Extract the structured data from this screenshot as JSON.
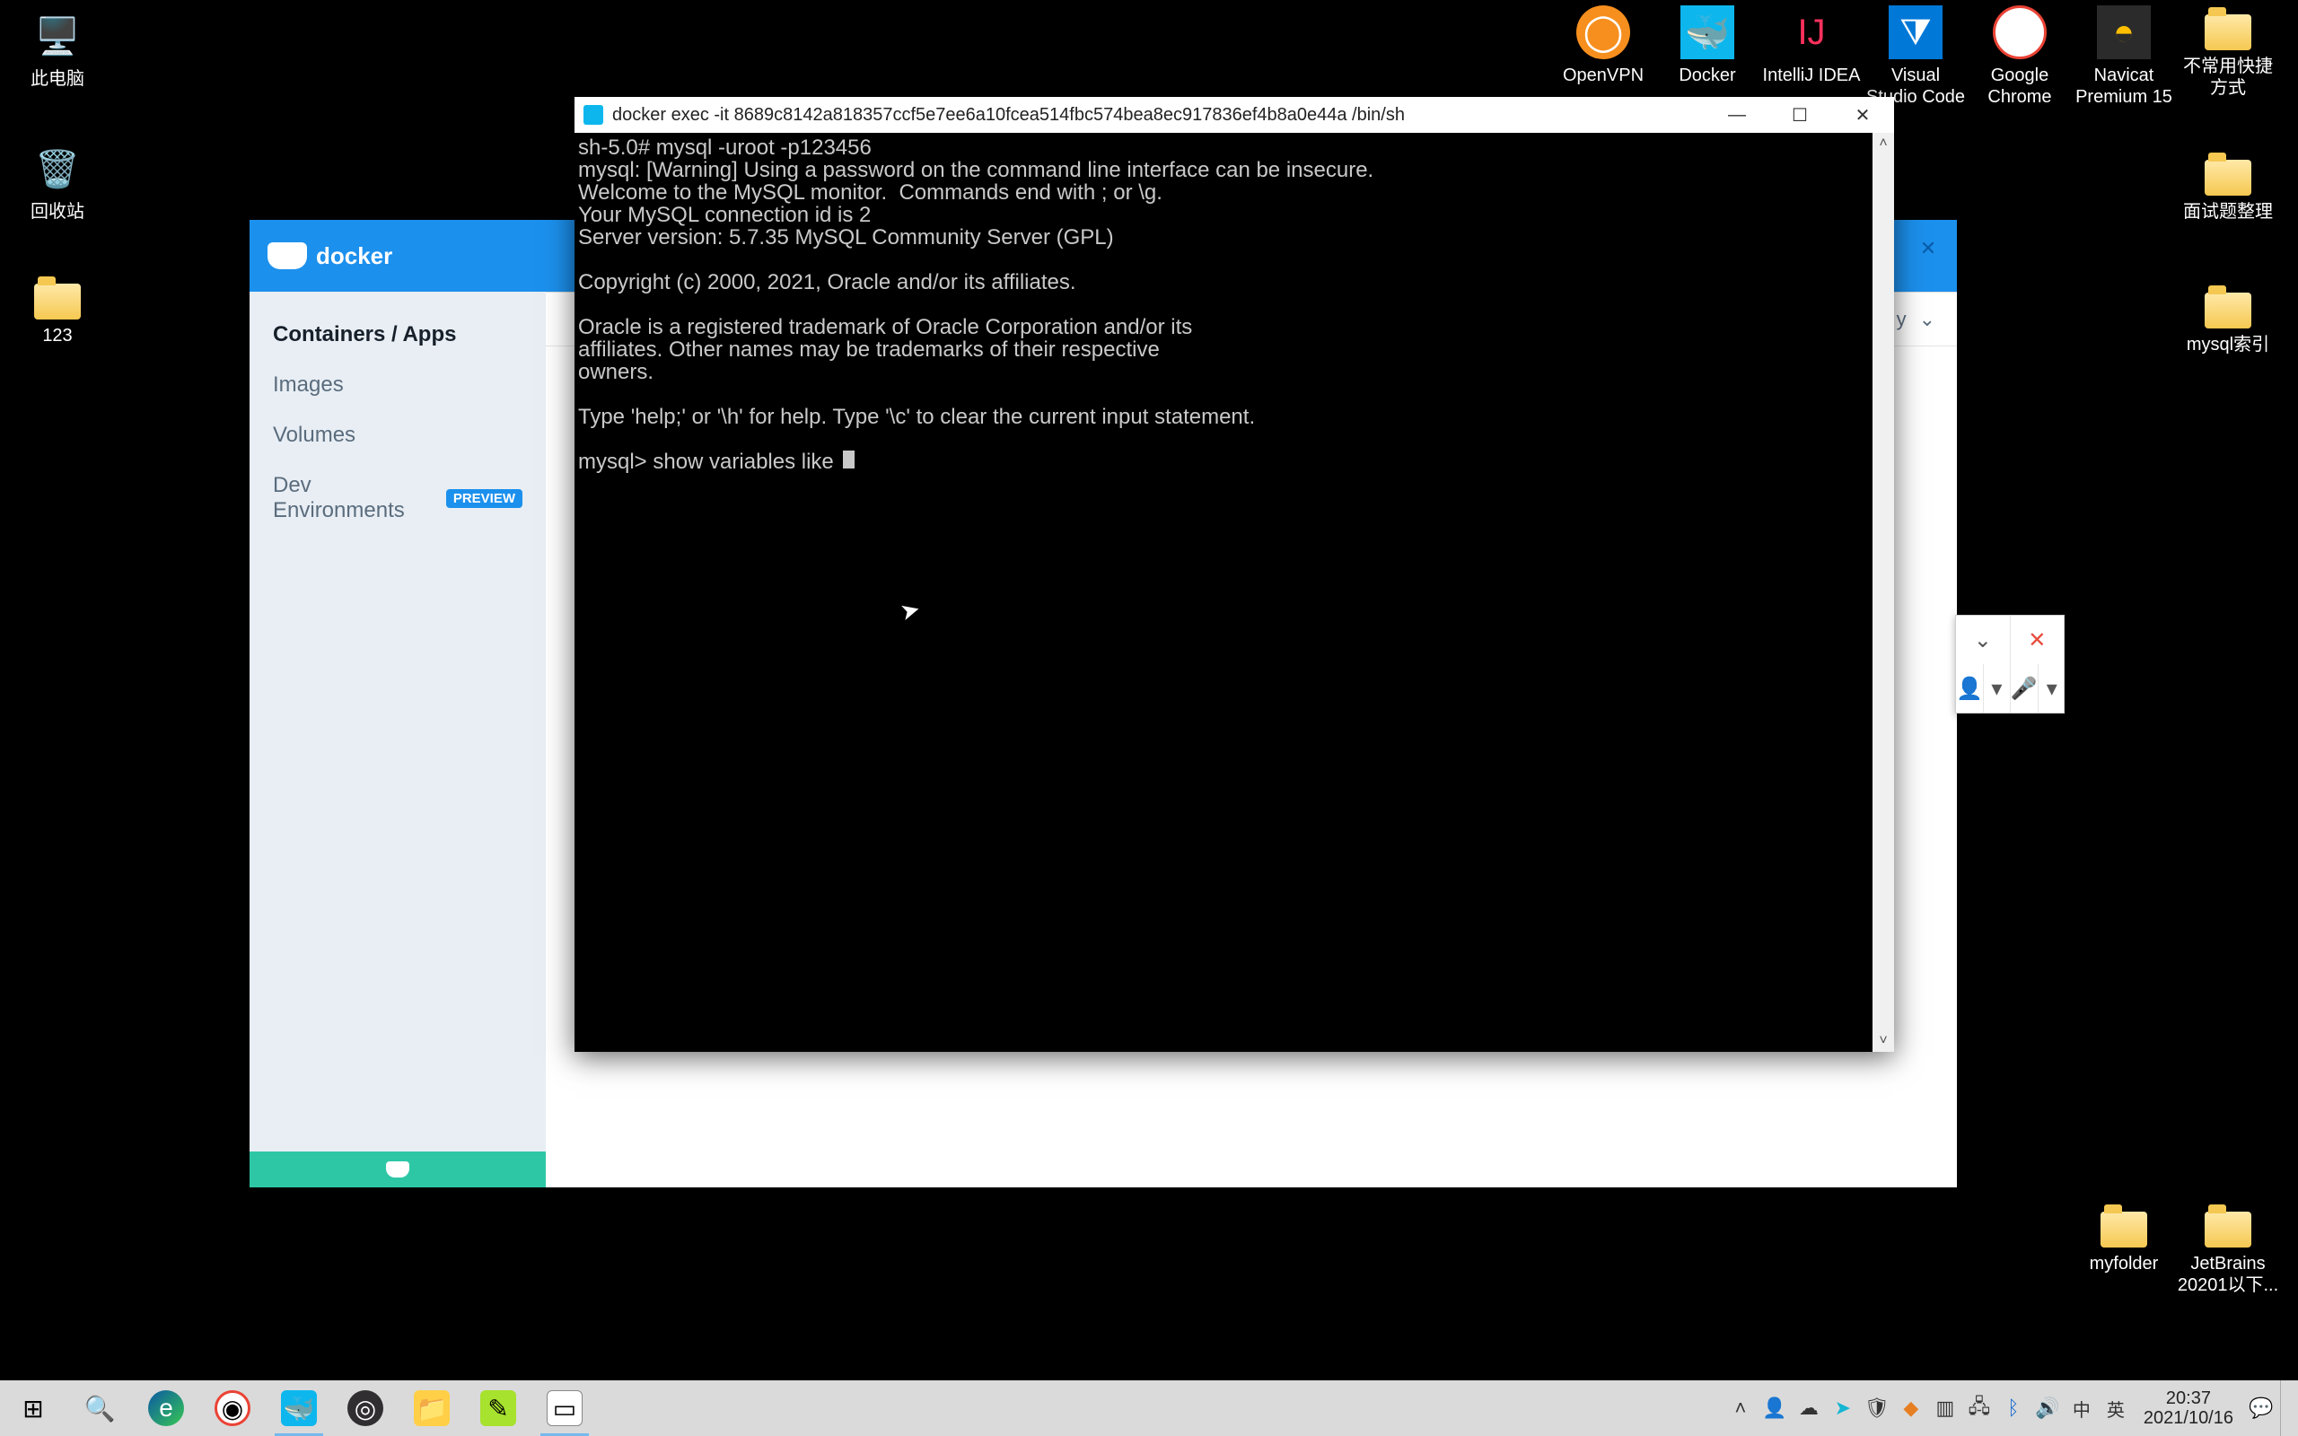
{
  "desktop": {
    "left": [
      {
        "label": "此电脑",
        "icon": "pc"
      },
      {
        "label": "回收站",
        "icon": "bin"
      },
      {
        "label": "123",
        "icon": "folder"
      }
    ],
    "topRight": [
      {
        "label": "OpenVPN"
      },
      {
        "label": "Docker"
      },
      {
        "label": "IntelliJ IDEA"
      },
      {
        "label": "Visual Studio Code"
      },
      {
        "label": "Google Chrome"
      },
      {
        "label": "Navicat Premium 15"
      },
      {
        "label": "不常用快捷方式"
      }
    ],
    "rightCol": [
      {
        "label": "面试题整理"
      },
      {
        "label": "mysql索引"
      }
    ],
    "bottomRight": [
      {
        "label": "myfolder"
      },
      {
        "label": "JetBrains 20201以下..."
      }
    ]
  },
  "dockerWindow": {
    "logoText": "docker",
    "sidebar": [
      {
        "label": "Containers / Apps",
        "active": true
      },
      {
        "label": "Images"
      },
      {
        "label": "Volumes"
      },
      {
        "label": "Dev Environments",
        "badge": "PREVIEW"
      }
    ],
    "toolbarSort": "y"
  },
  "terminal": {
    "title": "docker  exec -it 8689c8142a818357ccf5e7ee6a10fcea514fbc574bea8ec917836ef4b8a0e44a /bin/sh",
    "lines": "sh-5.0# mysql -uroot -p123456\nmysql: [Warning] Using a password on the command line interface can be insecure.\nWelcome to the MySQL monitor.  Commands end with ; or \\g.\nYour MySQL connection id is 2\nServer version: 5.7.35 MySQL Community Server (GPL)\n\nCopyright (c) 2000, 2021, Oracle and/or its affiliates.\n\nOracle is a registered trademark of Oracle Corporation and/or its\naffiliates. Other names may be trademarks of their respective\nowners.\n\nType 'help;' or '\\h' for help. Type '\\c' to clear the current input statement.\n\nmysql> show variables like "
  },
  "taskbar": {
    "time": "20:37",
    "date": "2021/10/16",
    "ime": "英",
    "lang": "中"
  }
}
